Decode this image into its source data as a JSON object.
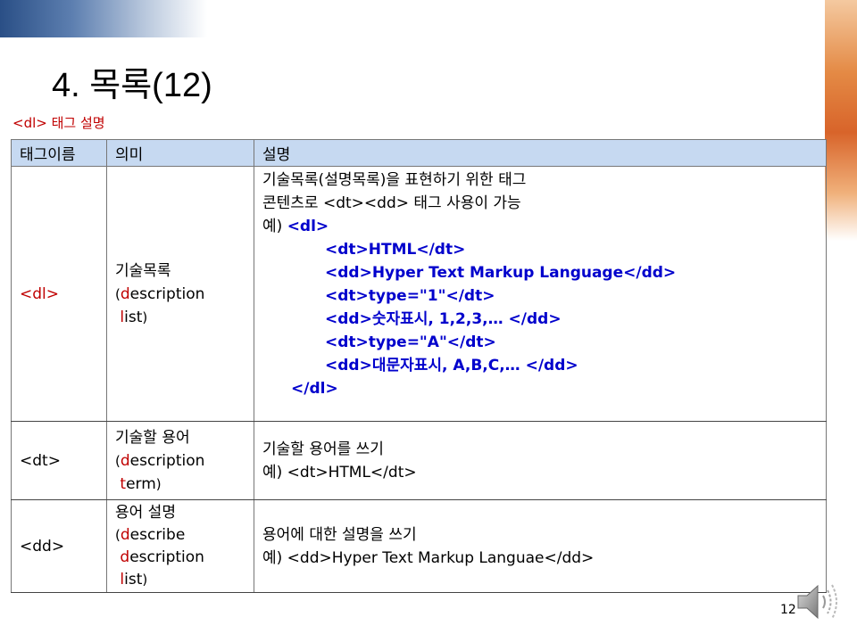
{
  "title": "4. 목록(12)",
  "subtitle": "<dl> 태그 설명",
  "table": {
    "headers": [
      "태그이름",
      "의미",
      "설명"
    ],
    "rows": [
      {
        "tag": "<dl>",
        "meaning": {
          "line1": "기술목록",
          "open": "(",
          "word1_first": "d",
          "word1_rest": "escription",
          "word2_first": "l",
          "word2_rest": "ist",
          "close": ")"
        },
        "description": {
          "line1": "기술목록(설명목록)을 표현하기 위한 태그",
          "line2": "콘텐츠로 <dt><dd> 태그 사용이 가능",
          "example_prefix": "예) ",
          "example_open": "<dl>",
          "code_lines": [
            "<dt>HTML</dt>",
            "<dd>Hyper Text Markup Language</dd>",
            "<dt>type=\"1\"</dt>",
            "<dd>숫자표시, 1,2,3,… </dd>",
            "<dt>type=\"A\"</dt>",
            "<dd>대문자표시, A,B,C,… </dd>"
          ],
          "example_close": "</dl>"
        }
      },
      {
        "tag": "<dt>",
        "meaning": {
          "line1": "기술할 용어",
          "open": "(",
          "word1_first": "d",
          "word1_rest": "escription",
          "word2_first": "t",
          "word2_rest": "erm",
          "close": ")"
        },
        "description": {
          "line1": "기술할 용어를 쓰기",
          "line2": "예) <dt>HTML</dt>"
        }
      },
      {
        "tag": "<dd>",
        "meaning": {
          "line1": "용어 설명",
          "open": "(",
          "word1_first": "d",
          "word1_rest": "escribe",
          "word2_first": "d",
          "word2_rest": "escription",
          "word3_first": "l",
          "word3_rest": "ist",
          "close": ")"
        },
        "description": {
          "line1": "용어에 대한 설명을 쓰기",
          "line2": "예) <dd>Hyper Text Markup Languae</dd>"
        }
      }
    ]
  },
  "page_number": "12",
  "icons": {
    "speaker": "speaker-icon"
  }
}
